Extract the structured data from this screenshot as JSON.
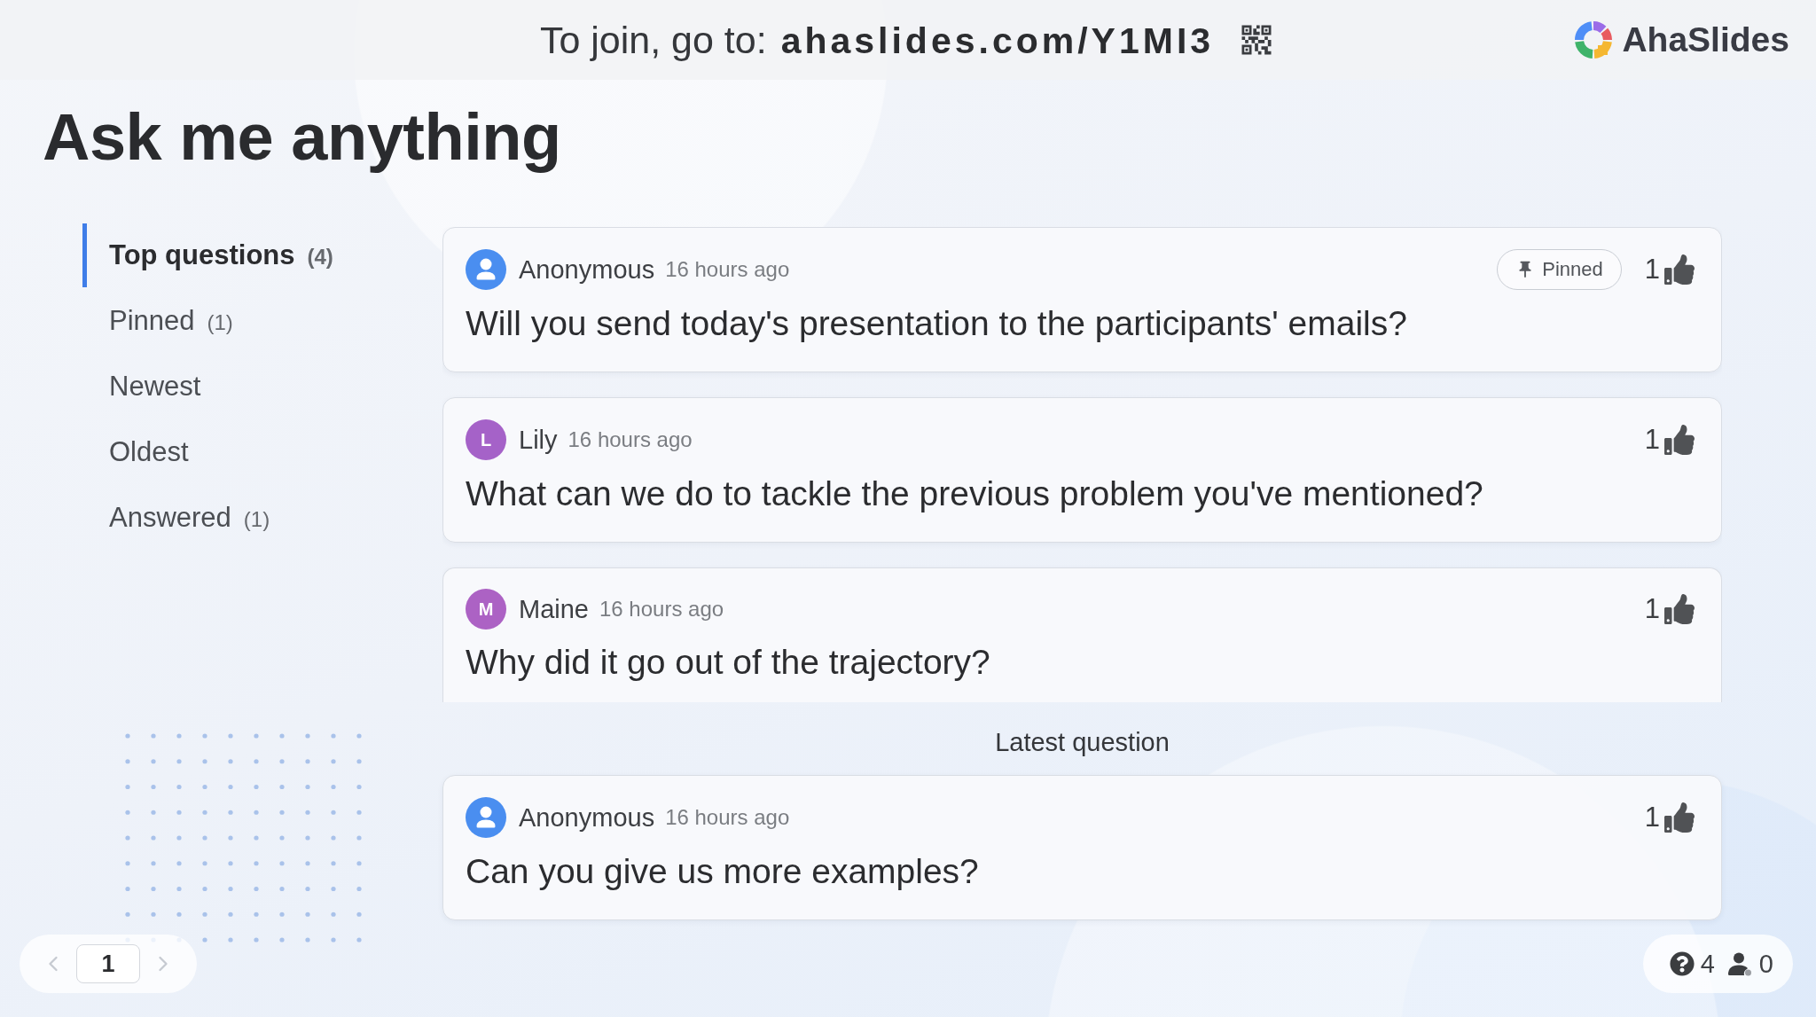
{
  "header": {
    "join_text": "To join, go to: **ahaslides.com/Y1MI3**",
    "logo_text": "AhaSlides"
  },
  "title": "Ask me anything",
  "sidebar": {
    "items": [
      {
        "label": "Top questions",
        "count": "(4)",
        "selected": true
      },
      {
        "label": "Pinned",
        "count": "(1)",
        "selected": false
      },
      {
        "label": "Newest",
        "selected": false
      },
      {
        "label": "Oldest",
        "selected": false
      },
      {
        "label": "Answered",
        "count": "(1)",
        "selected": false
      }
    ]
  },
  "questions": [
    {
      "author": {
        "kind": "anonymous",
        "name": "Anonymous",
        "color": "#4a8ef0"
      },
      "time": "16 hours ago",
      "text": "Will you send today's presentation to the participants' emails?",
      "pinned": true,
      "pin_label": "Pinned",
      "likes": "1"
    },
    {
      "author": {
        "kind": "initial",
        "initial": "L",
        "name": "Lily",
        "color": "#a562c8"
      },
      "time": "16 hours ago",
      "text": "What can we do to tackle the previous problem you've mentioned?",
      "pinned": false,
      "likes": "1"
    },
    {
      "author": {
        "kind": "initial",
        "initial": "M",
        "name": "Maine",
        "color": "#ac62c4"
      },
      "time": "16 hours ago",
      "text": "Why did it go out of the trajectory?",
      "pinned": false,
      "likes": "1"
    }
  ],
  "latest": {
    "heading": "Latest question",
    "question": {
      "author": {
        "kind": "anonymous",
        "name": "Anonymous",
        "color": "#4a8ef0"
      },
      "time": "16 hours ago",
      "text": "Can you give us more examples?",
      "pinned": false,
      "likes": "1"
    }
  },
  "pager": {
    "page": "1",
    "previous_disabled": true,
    "next_disabled": true
  },
  "stats": {
    "questions": "4",
    "participants": "0"
  }
}
